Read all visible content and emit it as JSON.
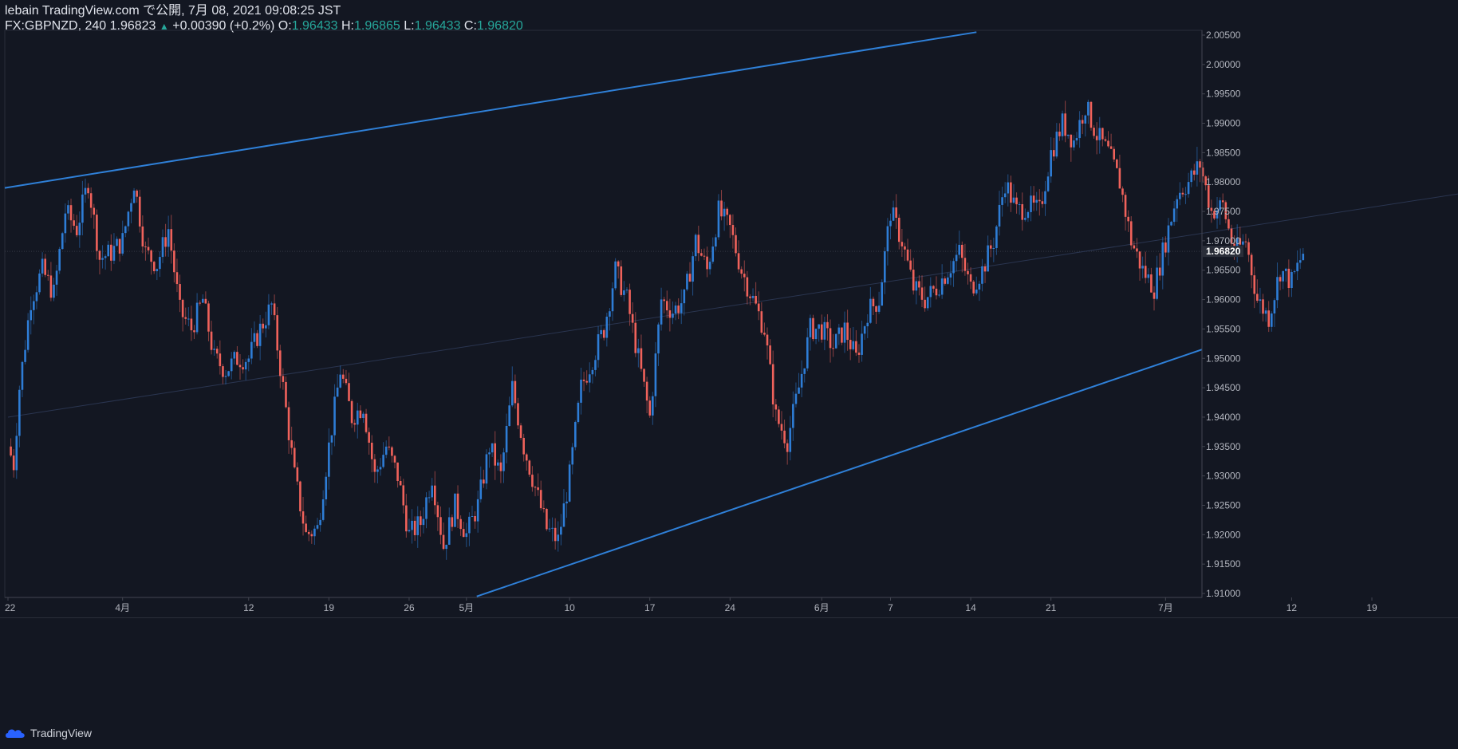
{
  "header": {
    "line1": "lebain TradingView.com で公開, 7月 08, 2021 09:08:25 JST",
    "symbol": "FX:GBPNZD, 240",
    "last": "1.96823",
    "change": "+0.00390 (+0.2%)",
    "o_label": "O:",
    "o_value": "1.96433",
    "h_label": "H:",
    "h_value": "1.96865",
    "l_label": "L:",
    "l_value": "1.96433",
    "c_label": "C:",
    "c_value": "1.96820"
  },
  "footer": {
    "brand": "TradingView"
  },
  "colors": {
    "background": "#131722",
    "up": "#2e7dd6",
    "down": "#f0625b",
    "channel": "#2f80d8",
    "text": "#b2b5be"
  },
  "chart_data": {
    "type": "candlestick",
    "symbol": "FX:GBPNZD",
    "interval": "240",
    "y_range": [
      1.91,
      2.005
    ],
    "y_ticks": [
      1.91,
      1.915,
      1.92,
      1.925,
      1.93,
      1.935,
      1.94,
      1.945,
      1.95,
      1.955,
      1.96,
      1.965,
      1.97,
      1.975,
      1.98,
      1.985,
      1.99,
      1.995,
      2.0,
      2.005
    ],
    "current_price": 1.9682,
    "x_ticks": [
      {
        "label": "22",
        "day": 0
      },
      {
        "label": "4月",
        "day": 10
      },
      {
        "label": "12",
        "day": 21
      },
      {
        "label": "19",
        "day": 28
      },
      {
        "label": "26",
        "day": 35
      },
      {
        "label": "5月",
        "day": 40
      },
      {
        "label": "10",
        "day": 49
      },
      {
        "label": "17",
        "day": 56
      },
      {
        "label": "24",
        "day": 63
      },
      {
        "label": "6月",
        "day": 71
      },
      {
        "label": "7",
        "day": 77
      },
      {
        "label": "14",
        "day": 84
      },
      {
        "label": "21",
        "day": 91
      },
      {
        "label": "7月",
        "day": 101
      },
      {
        "label": "12",
        "day": 112
      },
      {
        "label": "19",
        "day": 119
      }
    ],
    "path_points": [
      [
        0,
        1.935
      ],
      [
        0.5,
        1.932
      ],
      [
        1,
        1.945
      ],
      [
        2,
        1.96
      ],
      [
        3,
        1.965
      ],
      [
        4,
        1.961
      ],
      [
        5,
        1.975
      ],
      [
        6,
        1.972
      ],
      [
        7,
        1.98
      ],
      [
        8,
        1.967
      ],
      [
        9,
        1.968
      ],
      [
        10,
        1.97
      ],
      [
        11,
        1.98
      ],
      [
        12,
        1.968
      ],
      [
        13,
        1.966
      ],
      [
        14,
        1.972
      ],
      [
        15,
        1.958
      ],
      [
        16,
        1.955
      ],
      [
        17,
        1.96
      ],
      [
        18,
        1.95
      ],
      [
        19,
        1.948
      ],
      [
        20,
        1.95
      ],
      [
        21,
        1.95
      ],
      [
        22,
        1.955
      ],
      [
        23,
        1.959
      ],
      [
        24,
        1.945
      ],
      [
        25,
        1.93
      ],
      [
        26,
        1.92
      ],
      [
        27,
        1.921
      ],
      [
        28,
        1.935
      ],
      [
        29,
        1.948
      ],
      [
        30,
        1.94
      ],
      [
        31,
        1.942
      ],
      [
        32,
        1.93
      ],
      [
        33,
        1.935
      ],
      [
        34,
        1.93
      ],
      [
        35,
        1.92
      ],
      [
        36,
        1.922
      ],
      [
        37,
        1.93
      ],
      [
        38,
        1.918
      ],
      [
        39,
        1.925
      ],
      [
        40,
        1.92
      ],
      [
        41,
        1.925
      ],
      [
        42,
        1.935
      ],
      [
        43,
        1.93
      ],
      [
        44,
        1.945
      ],
      [
        45,
        1.935
      ],
      [
        46,
        1.928
      ],
      [
        47,
        1.921
      ],
      [
        48,
        1.919
      ],
      [
        49,
        1.93
      ],
      [
        50,
        1.945
      ],
      [
        51,
        1.95
      ],
      [
        52,
        1.955
      ],
      [
        53,
        1.965
      ],
      [
        54,
        1.96
      ],
      [
        55,
        1.95
      ],
      [
        56,
        1.94
      ],
      [
        57,
        1.96
      ],
      [
        58,
        1.958
      ],
      [
        59,
        1.96
      ],
      [
        60,
        1.97
      ],
      [
        61,
        1.965
      ],
      [
        62,
        1.975
      ],
      [
        63,
        1.972
      ],
      [
        64,
        1.965
      ],
      [
        65,
        1.96
      ],
      [
        66,
        1.955
      ],
      [
        67,
        1.94
      ],
      [
        68,
        1.936
      ],
      [
        69,
        1.945
      ],
      [
        70,
        1.955
      ],
      [
        71,
        1.955
      ],
      [
        72,
        1.952
      ],
      [
        73,
        1.955
      ],
      [
        74,
        1.95
      ],
      [
        75,
        1.958
      ],
      [
        76,
        1.96
      ],
      [
        77,
        1.975
      ],
      [
        78,
        1.97
      ],
      [
        79,
        1.962
      ],
      [
        80,
        1.96
      ],
      [
        81,
        1.962
      ],
      [
        82,
        1.965
      ],
      [
        83,
        1.968
      ],
      [
        84,
        1.962
      ],
      [
        85,
        1.965
      ],
      [
        86,
        1.97
      ],
      [
        87,
        1.98
      ],
      [
        88,
        1.975
      ],
      [
        89,
        1.976
      ],
      [
        90,
        1.975
      ],
      [
        91,
        1.985
      ],
      [
        92,
        1.99
      ],
      [
        93,
        1.987
      ],
      [
        94,
        1.993
      ],
      [
        95,
        1.988
      ],
      [
        96,
        1.985
      ],
      [
        97,
        1.98
      ],
      [
        98,
        1.97
      ],
      [
        99,
        1.965
      ],
      [
        100,
        1.962
      ],
      [
        101,
        1.97
      ],
      [
        102,
        1.978
      ],
      [
        103,
        1.98
      ],
      [
        104,
        1.983
      ],
      [
        105,
        1.975
      ],
      [
        106,
        1.976
      ],
      [
        107,
        1.968
      ],
      [
        108,
        1.97
      ],
      [
        109,
        1.96
      ],
      [
        110,
        1.957
      ],
      [
        111,
        1.965
      ],
      [
        112,
        1.963
      ],
      [
        113,
        1.968
      ]
    ],
    "channel": {
      "upper": [
        [
          0,
          1.979
        ],
        [
          84.5,
          2.0055
        ]
      ],
      "lower": [
        [
          40.9,
          1.9095
        ],
        [
          179.7,
          1.9515
        ]
      ],
      "middle": [
        [
          0,
          1.94
        ],
        [
          174.9,
          1.9925
        ]
      ]
    }
  }
}
